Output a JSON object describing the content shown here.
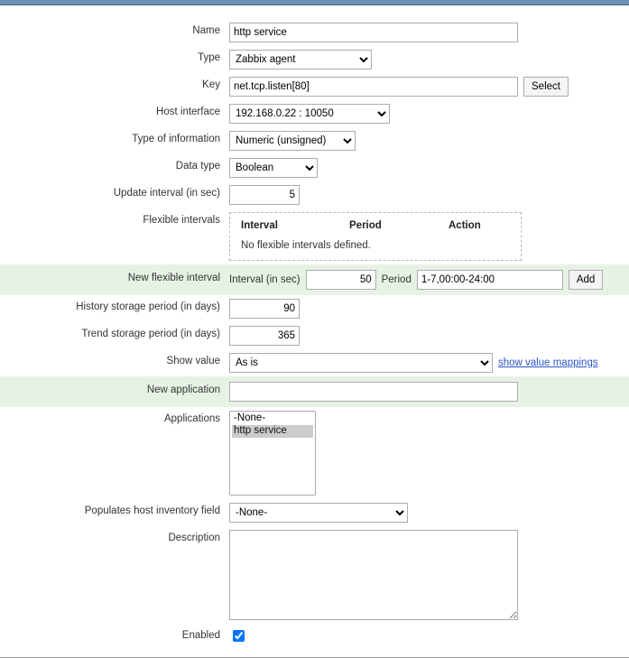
{
  "labels": {
    "name": "Name",
    "type": "Type",
    "key": "Key",
    "host_interface": "Host interface",
    "type_of_info": "Type of information",
    "data_type": "Data type",
    "update_interval": "Update interval (in sec)",
    "flex_intervals": "Flexible intervals",
    "new_flex": "New flexible interval",
    "history": "History storage period (in days)",
    "trend": "Trend storage period (in days)",
    "show_value": "Show value",
    "new_app": "New application",
    "apps": "Applications",
    "inventory": "Populates host inventory field",
    "desc": "Description",
    "enabled": "Enabled"
  },
  "buttons": {
    "select": "Select",
    "add": "Add"
  },
  "values": {
    "name": "http service",
    "type": "Zabbix agent",
    "key": "net.tcp.listen[80]",
    "host_interface": "192.168.0.22 : 10050",
    "type_of_info": "Numeric (unsigned)",
    "data_type": "Boolean",
    "update_interval": "5",
    "history": "90",
    "trend": "365",
    "show_value": "As is",
    "new_app": "",
    "inventory": "-None-",
    "desc": ""
  },
  "flex_table": {
    "col_interval": "Interval",
    "col_period": "Period",
    "col_action": "Action",
    "empty": "No flexible intervals defined."
  },
  "new_flex": {
    "interval_label": "Interval (in sec)",
    "interval_value": "50",
    "period_label": "Period",
    "period_value": "1-7,00:00-24:00"
  },
  "links": {
    "show_value_mappings": "show value mappings"
  },
  "apps_options": {
    "none": "-None-",
    "http": "http service"
  }
}
